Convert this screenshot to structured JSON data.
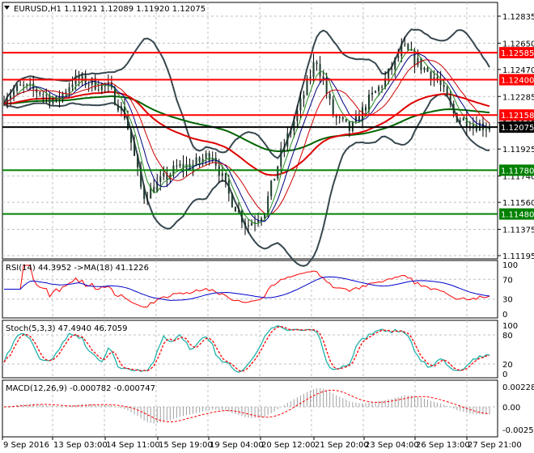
{
  "header": {
    "symbol": "EURUSD,H1",
    "open": "1.11921",
    "high": "1.12089",
    "low": "1.11920",
    "close": "1.12075"
  },
  "colors": {
    "up_line": "#ff0000",
    "support": "#008000",
    "bg": "#ffffff",
    "grid": "#c0c0c0",
    "rsi": "#0000cd",
    "stoch": "#20b2aa",
    "macd_hist": "#c0c0c0"
  },
  "chart_data": {
    "type": "line",
    "title": "EURUSD,H1",
    "price_axis_ticks": [
      "1.12835",
      "1.12650",
      "1.12470",
      "1.12285",
      "1.12105",
      "1.11925",
      "1.11740",
      "1.11560",
      "1.11375",
      "1.11195"
    ],
    "ylim": [
      1.11195,
      1.12835
    ],
    "time_labels": [
      "9 Sep 2016",
      "13 Sep 03:00",
      "14 Sep 11:00",
      "15 Sep 19:00",
      "19 Sep 04:00",
      "20 Sep 12:00",
      "21 Sep 20:00",
      "23 Sep 04:00",
      "26 Sep 13:00",
      "27 Sep 21:00"
    ],
    "approx_close_path": [
      1.1228,
      1.1235,
      1.1232,
      1.1225,
      1.124,
      1.1238,
      1.1235,
      1.1215,
      1.116,
      1.117,
      1.118,
      1.1182,
      1.119,
      1.116,
      1.114,
      1.115,
      1.119,
      1.122,
      1.1255,
      1.1215,
      1.1205,
      1.1225,
      1.124,
      1.1262,
      1.125,
      1.124,
      1.1215,
      1.121,
      1.12075
    ],
    "resistance_levels": [
      {
        "value": 1.12585,
        "label": "1.12585"
      },
      {
        "value": 1.124,
        "label": "1.12400"
      },
      {
        "value": 1.12158,
        "label": "1.12158"
      }
    ],
    "support_levels": [
      {
        "value": 1.1178,
        "label": "1.11780"
      },
      {
        "value": 1.1148,
        "label": "1.11480"
      }
    ],
    "current_price": {
      "value": 1.12075,
      "label": "1.12075"
    },
    "rsi": {
      "title": "RSI(14) 44.3952  ->MA(18) 41.1226",
      "ticks": [
        "100",
        "70",
        "30",
        "0"
      ]
    },
    "stoch": {
      "title": "Stoch(5,3,3) 47.4940 46.7059",
      "ticks": [
        "100",
        "80",
        "20",
        "0"
      ]
    },
    "macd": {
      "title": "MACD(12,26,9) -0.000782 -0.000747",
      "ticks": [
        "0.002288",
        "0.00",
        "-0.002579"
      ]
    }
  }
}
